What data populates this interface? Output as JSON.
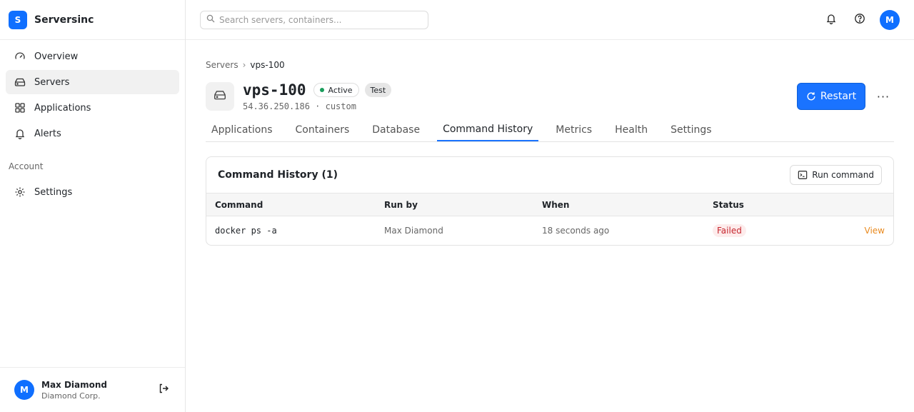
{
  "brand": {
    "logo_letter": "S",
    "name": "Serversinc"
  },
  "sidebar": {
    "items": [
      {
        "label": "Overview",
        "icon": "gauge-icon"
      },
      {
        "label": "Servers",
        "icon": "hard-drive-icon",
        "active": true
      },
      {
        "label": "Applications",
        "icon": "grid-icon"
      },
      {
        "label": "Alerts",
        "icon": "bell-icon"
      }
    ],
    "account_heading": "Account",
    "account_items": [
      {
        "label": "Settings",
        "icon": "gear-icon"
      }
    ]
  },
  "user": {
    "initial": "M",
    "name": "Max Diamond",
    "org": "Diamond Corp."
  },
  "topbar": {
    "search_placeholder": "Search servers, containers...",
    "avatar_initial": "M"
  },
  "breadcrumb": {
    "parent": "Servers",
    "separator": "›",
    "current": "vps-100"
  },
  "server": {
    "name": "vps-100",
    "status": "Active",
    "environment": "Test",
    "subtitle": "54.36.250.186 · custom",
    "restart_label": "Restart",
    "more_label": "···"
  },
  "tabs": [
    "Applications",
    "Containers",
    "Database",
    "Command History",
    "Metrics",
    "Health",
    "Settings"
  ],
  "active_tab": "Command History",
  "command_history": {
    "title": "Command History (1)",
    "run_button": "Run command",
    "columns": [
      "Command",
      "Run by",
      "When",
      "Status",
      ""
    ],
    "rows": [
      {
        "command": "docker ps -a",
        "run_by": "Max Diamond",
        "when": "18 seconds ago",
        "status": "Failed",
        "action": "View"
      }
    ]
  },
  "colors": {
    "accent": "#1a73ff",
    "brand": "#0f6fff",
    "failed": "#c6262e",
    "link": "#e98a1f",
    "active_dot": "#1a9d5c"
  }
}
